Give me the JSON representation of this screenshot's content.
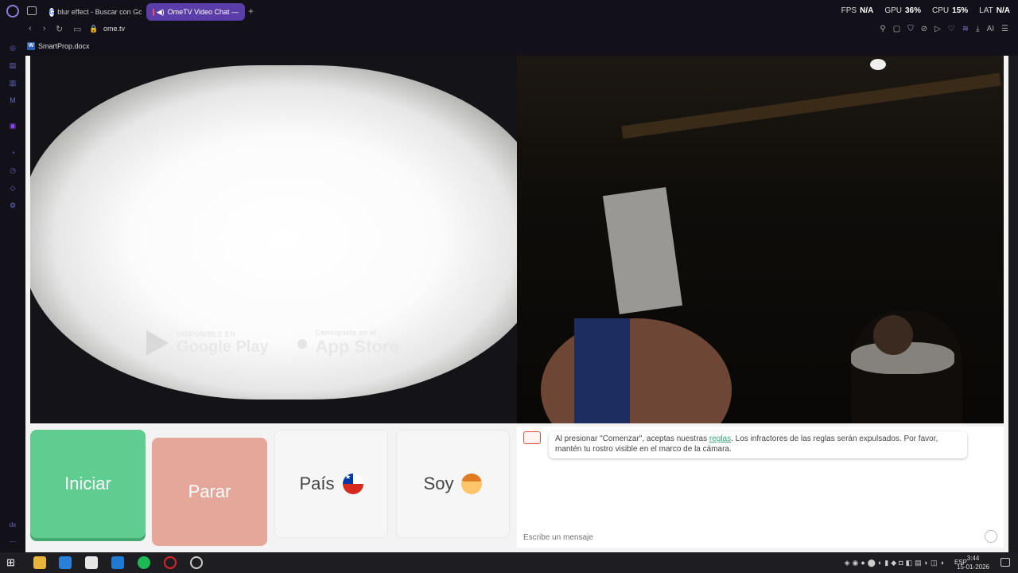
{
  "browser": {
    "tabs": [
      {
        "title": "blur effect - Buscar con Go",
        "active": false
      },
      {
        "title": "OmeTV Video Chat —",
        "active": true
      }
    ],
    "new_tab": "+",
    "url": "ome.tv",
    "bookmark": "SmartProp.docx",
    "accent_color": "#5a3da8"
  },
  "perf": {
    "fps_label": "FPS",
    "fps_value": "N/A",
    "gpu_label": "GPU",
    "gpu_value": "36%",
    "cpu_label": "CPU",
    "cpu_value": "15%",
    "lat_label": "LAT",
    "lat_value": "N/A"
  },
  "toolbar_ai": "AI",
  "video_left": {
    "google_play_small": "DISPONIBLE EN",
    "google_play_big": "Google Play",
    "app_store_small": "Consíguelo en el",
    "app_store_big": "App Store"
  },
  "controls": {
    "start": "Iniciar",
    "stop": "Parar",
    "country": "País",
    "soy": "Soy",
    "start_color": "#5ecd8f",
    "stop_color": "#e6a79b"
  },
  "chat": {
    "intro_before": "Al presionar \"Comenzar\", aceptas nuestras ",
    "rules_link": "reglas",
    "intro_after": ". Los infractores de las reglas serán expulsados. Por favor, mantén tu rostro visible en el marco de la cámara.",
    "placeholder": "Escribe un mensaje"
  },
  "taskbar": {
    "lang": "ESP",
    "time": "3:44",
    "date": "15-01-2026"
  },
  "sidebar_bottom": "dx"
}
